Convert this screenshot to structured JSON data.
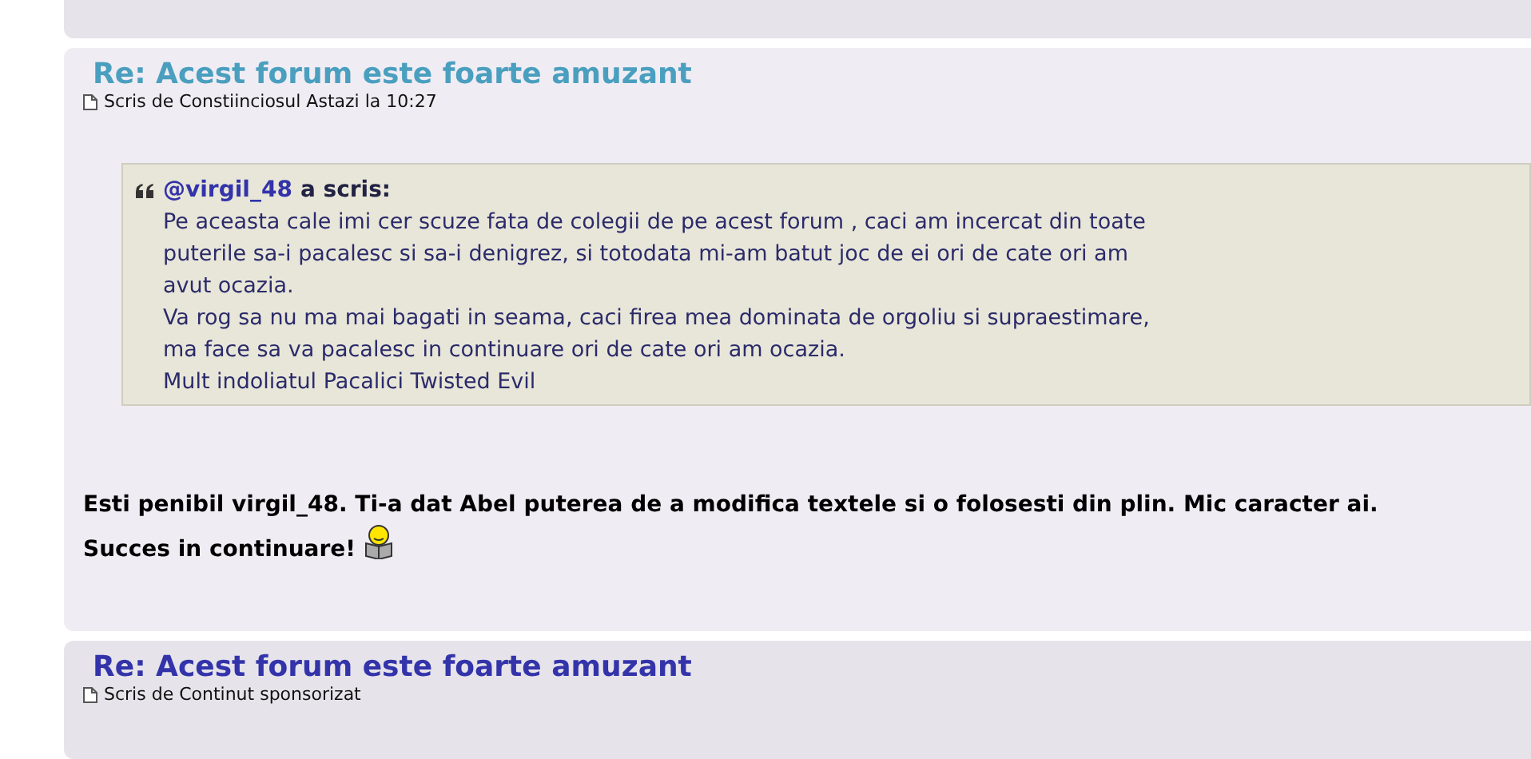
{
  "posts": [
    {
      "kind": "partial"
    },
    {
      "kind": "full",
      "title": "Re: Acest forum este foarte amuzant",
      "color": "#4a9fbf",
      "meta": "Scris de Constiinciosul Astazi la 10:27",
      "quote": {
        "author": "@virgil_48",
        "wrote": "a scris:",
        "lines": [
          "Pe aceasta cale imi cer scuze fata de colegii de pe acest forum , caci am incercat din toate",
          "puterile sa-i pacalesc si sa-i denigrez, si totodata mi-am batut joc de ei ori de cate ori am",
          "avut ocazia.",
          "Va rog sa nu ma mai bagati in seama, caci firea mea dominata de orgoliu si supraestimare,",
          "ma face sa va pacalesc in continuare ori de cate ori am ocazia.",
          "Mult indoliatul Pacalici Twisted Evil"
        ]
      },
      "body": [
        "Esti penibil virgil_48. Ti-a dat Abel puterea de a modifica textele si o folosesti din plin. Mic caracter ai.",
        "Succes in continuare!"
      ]
    },
    {
      "kind": "header",
      "title": "Re: Acest forum este foarte amuzant",
      "color": "#3333aa",
      "meta": "Scris de Continut sponsorizat"
    }
  ]
}
